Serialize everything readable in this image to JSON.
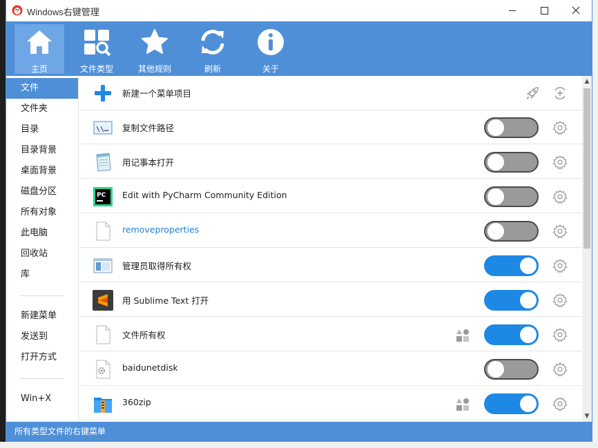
{
  "window": {
    "title": "Windows右键管理",
    "min_icon": "minimize-icon",
    "max_icon": "maximize-icon",
    "close_icon": "close-icon"
  },
  "toolbar": [
    {
      "label": "主页",
      "icon": "home-icon",
      "active": true
    },
    {
      "label": "文件类型",
      "icon": "file-types-icon",
      "active": false
    },
    {
      "label": "其他规则",
      "icon": "star-icon",
      "active": false
    },
    {
      "label": "刷新",
      "icon": "refresh-icon",
      "active": false
    },
    {
      "label": "关于",
      "icon": "info-icon",
      "active": false
    }
  ],
  "sidebar": {
    "group1": [
      "文件",
      "文件夹",
      "目录",
      "目录背景",
      "桌面背景",
      "磁盘分区",
      "所有对象",
      "此电脑",
      "回收站",
      "库"
    ],
    "group2": [
      "新建菜单",
      "发送到",
      "打开方式"
    ],
    "group3": [
      "Win+X"
    ],
    "active": "文件"
  },
  "list": {
    "new_item": {
      "label": "新建一个菜单项目",
      "icons": [
        "rocket-icon",
        "add-circle-icon"
      ]
    },
    "items": [
      {
        "label": "复制文件路径",
        "icon": "copy-path-icon",
        "enabled": false,
        "extra": false
      },
      {
        "label": "用记事本打开",
        "icon": "notepad-icon",
        "enabled": false,
        "extra": false
      },
      {
        "label": "Edit with PyCharm Community Edition",
        "icon": "pycharm-icon",
        "enabled": false,
        "extra": false
      },
      {
        "label": "removeproperties",
        "icon": "blank-file-icon",
        "enabled": false,
        "extra": false,
        "link": true
      },
      {
        "label": "管理员取得所有权",
        "icon": "window-icon",
        "enabled": true,
        "extra": false
      },
      {
        "label": "用 Sublime Text 打开",
        "icon": "sublime-icon",
        "enabled": true,
        "extra": false
      },
      {
        "label": "文件所有权",
        "icon": "blank-file-icon",
        "enabled": true,
        "extra": true
      },
      {
        "label": "baidunetdisk",
        "icon": "gear-file-icon",
        "enabled": false,
        "extra": false
      },
      {
        "label": "360zip",
        "icon": "zip-icon",
        "enabled": true,
        "extra": true
      }
    ]
  },
  "statusbar": {
    "text": "所有类型文件的右键菜单"
  }
}
